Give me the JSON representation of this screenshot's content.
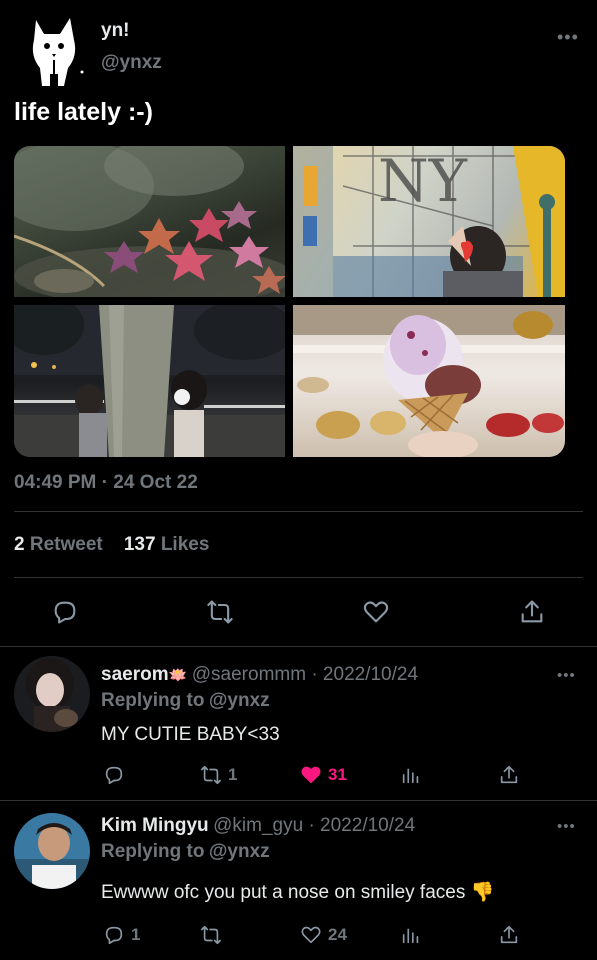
{
  "tweet": {
    "author_name": "yn!",
    "author_handle": "@ynxz",
    "text": "life lately :-)",
    "more_label": "•••",
    "timestamp": "04:49 PM · 24 Oct 22",
    "retweet_count": "2",
    "retweet_label": "Retweet",
    "like_count": "137",
    "like_label": "Likes",
    "media_text": "NY"
  },
  "replies": [
    {
      "name": "saerom",
      "name_emoji": "🪷",
      "handle_date": "@saerommm · 2022/10/24",
      "replying_prefix": "Replying to",
      "replying_to": "@ynxz",
      "text": "MY CUTIE BABY<33",
      "reply_count": "",
      "retweet_count": "1",
      "like_count": "31",
      "liked": true,
      "accent_like": "#f91880"
    },
    {
      "name": "Kim Mingyu",
      "name_emoji": "",
      "handle_date": "@kim_gyu · 2022/10/24",
      "replying_prefix": "Replying to",
      "replying_to": "@ynxz",
      "text": "Ewwww ofc you put a nose on smiley faces 👎",
      "reply_count": "1",
      "retweet_count": "",
      "like_count": "24",
      "liked": false
    }
  ],
  "colors": {
    "background": "#000000",
    "text": "#e7e9ea",
    "muted": "#71767b",
    "link": "#1d9bf0",
    "divider": "#2f3336"
  }
}
